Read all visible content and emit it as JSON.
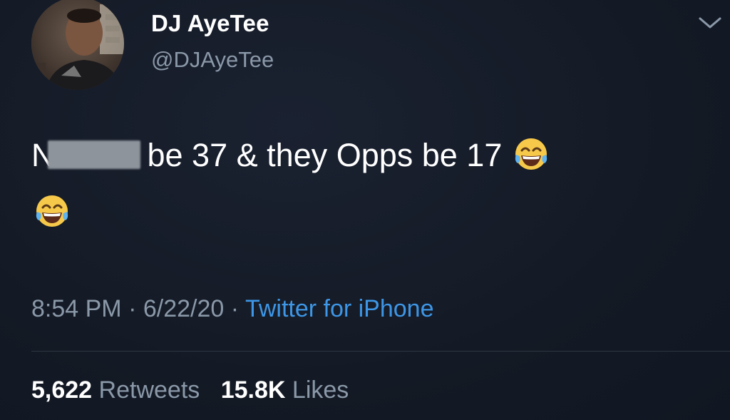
{
  "tweet": {
    "author": {
      "display_name": "DJ AyeTee",
      "handle": "@DJAyeTee"
    },
    "text": {
      "first_letter": "N",
      "after_redaction": "be 37 & they Opps be 17",
      "emoji": "face-with-tears-of-joy"
    },
    "meta": {
      "time": "8:54 PM",
      "separator": "·",
      "date": "6/22/20",
      "source": "Twitter for iPhone"
    },
    "stats": {
      "retweets_count": "5,622",
      "retweets_label": "Retweets",
      "likes_count": "15.8K",
      "likes_label": "Likes"
    }
  },
  "colors": {
    "background": "#151b26",
    "text_primary": "#ffffff",
    "text_secondary": "#8a98a8",
    "link": "#3d96e6",
    "divider": "#2d3643"
  },
  "icons": {
    "more": "chevron-down-icon",
    "emoji": "tears-of-joy-emoji-icon"
  }
}
